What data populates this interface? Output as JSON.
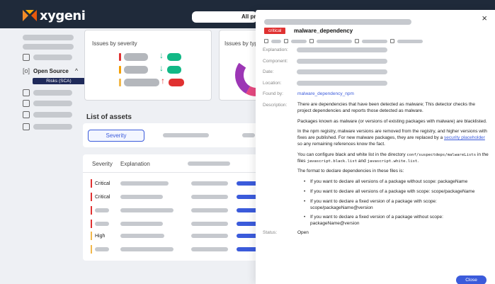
{
  "brand": {
    "name": "xygeni"
  },
  "topbar": {
    "search_label": "All pro"
  },
  "sidebar": {
    "open_source_label": "Open Source",
    "risks_sca_label": "Risks (SCA)"
  },
  "widgets": {
    "issues_by_severity_title": "Issues by severity",
    "issues_by_type_title": "Issues by typ"
  },
  "assets": {
    "title": "List of assets",
    "severity_button": "Severity",
    "table": {
      "headers": [
        "Severity",
        "Explanation"
      ],
      "rows": [
        {
          "severity": "Critical",
          "color": "#e03131"
        },
        {
          "severity": "Critical",
          "color": "#e03131"
        },
        {
          "severity": "",
          "color": "#e03131"
        },
        {
          "severity": "",
          "color": "#e03131"
        },
        {
          "severity": "High",
          "color": "#f2b84b"
        },
        {
          "severity": "",
          "color": "#f2b84b"
        }
      ]
    }
  },
  "drawer": {
    "close_icon": "×",
    "badge": "critical",
    "title": "malware_dependency",
    "labels": {
      "explanation": "Explanation:",
      "component": "Component:",
      "date": "Date:",
      "location": "Location:",
      "found_by": "Found by:",
      "description": "Description:",
      "status": "Status:"
    },
    "found_by_value": "malware_dependency_npm",
    "description": {
      "p1": "There are dependencies that have been detected as malware; This detector checks the project dependencies and reports those detected as malware.",
      "p2": "Packages known as malware (or versions of existing packages with malware) are blacklisted.",
      "p3_before": "In the npm registry, malware versions are removed from the registry, and higher versions with fixes are published. For new malware packages, they are replaced by a ",
      "p3_link": "security placeholder",
      "p3_after": " so any remaining references know the fact.",
      "p4_before": "You can configure black and white list in the directory ",
      "p4_code1": "conf/suspectdeps/malwareLists",
      "p4_mid": " in the files ",
      "p4_code2": "javascript.black.list",
      "p4_and": " and ",
      "p4_code3": "javascript.white.list",
      "p4_end": ".",
      "p5": "The format to declare dependencies in these files is:",
      "bullets": [
        "If you want to declare all versions of a package without scope: packageName",
        "If you want to declare all versions of a package with scope: scope/packageName",
        "If you want to declare a fixed version of a package with scope: scope/packageName@version",
        "If you want to declare a fixed version of a package without scope: packageName@version"
      ]
    },
    "status_value": "Open",
    "close_button": "Close"
  },
  "colors": {
    "critical": "#e03131",
    "high": "#f2b84b",
    "medium": "#f59f00",
    "accent": "#3b5bdb",
    "green": "#12b886"
  },
  "icons": [
    "logo-icon",
    "close-icon",
    "arrow-down-icon",
    "arrow-up-icon",
    "chevron-up-icon",
    "open-source-icon"
  ]
}
